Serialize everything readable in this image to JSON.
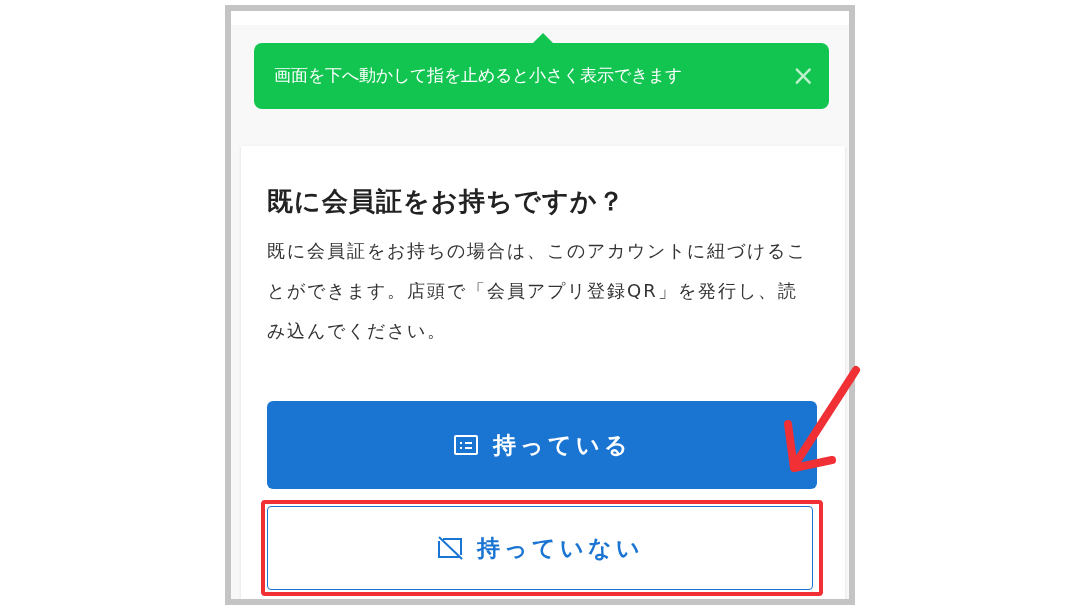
{
  "tooltip": {
    "text": "画面を下へ動かして指を止めると小さく表示できます",
    "close": "×"
  },
  "card": {
    "title": "既に会員証をお持ちですか？",
    "body": "既に会員証をお持ちの場合は、このアカウントに紐づけることができます。店頭で「会員アプリ登録QR」を発行し、読み込んでください。",
    "buttons": [
      {
        "label": "持っている",
        "kind": "primary",
        "highlighted": false
      },
      {
        "label": "持っていない",
        "kind": "outline",
        "highlighted": true
      }
    ]
  }
}
